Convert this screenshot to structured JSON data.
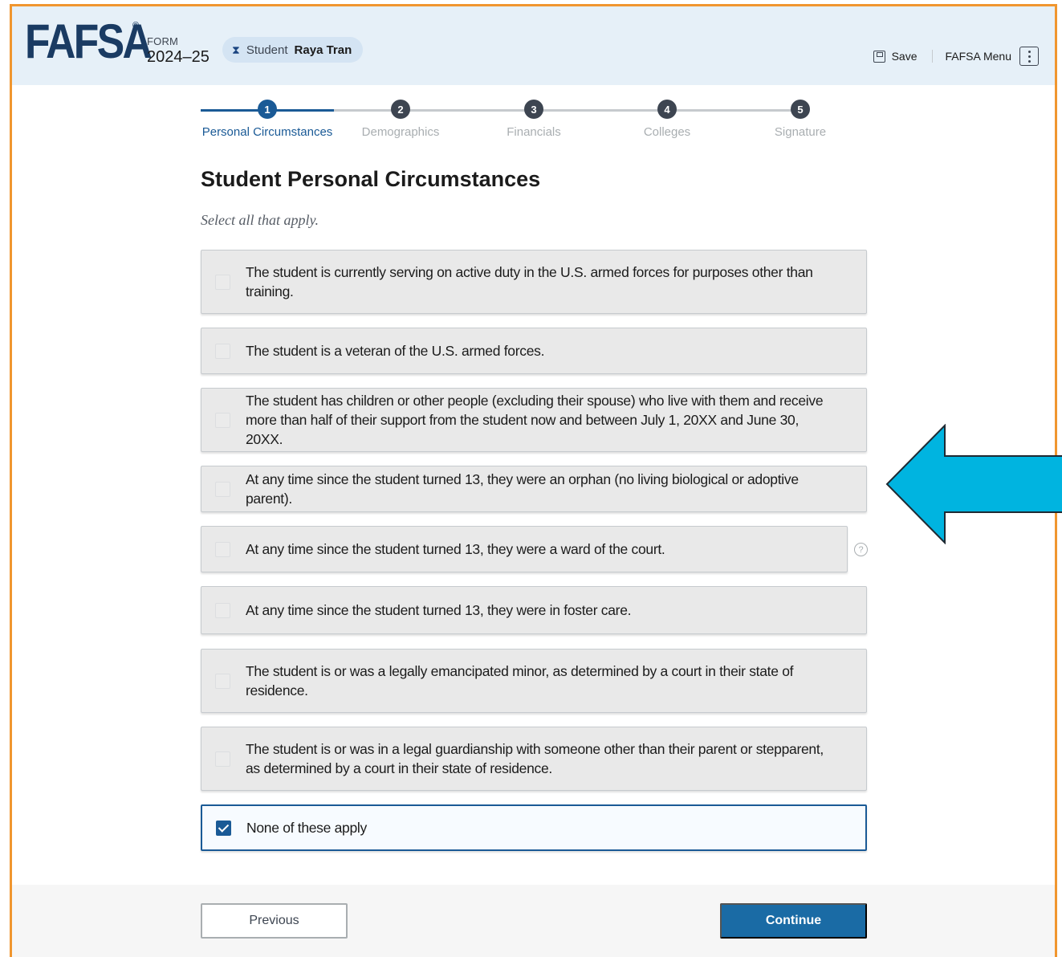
{
  "header": {
    "logo": "FAFSA",
    "logo_mark": "®",
    "form_label": "FORM",
    "form_year": "2024–25",
    "student_label": "Student",
    "student_name": "Raya Tran",
    "save_label": "Save",
    "menu_label": "FAFSA Menu",
    "student_icon": "hourglass-icon"
  },
  "stepper": {
    "active_step": 1,
    "steps": [
      {
        "number": "1",
        "label": "Personal Circumstances"
      },
      {
        "number": "2",
        "label": "Demographics"
      },
      {
        "number": "3",
        "label": "Financials"
      },
      {
        "number": "4",
        "label": "Colleges"
      },
      {
        "number": "5",
        "label": "Signature"
      }
    ]
  },
  "page": {
    "title": "Student Personal Circumstances",
    "subtitle": "Select all that apply."
  },
  "options": [
    {
      "text": "The student is currently serving on active duty in the U.S. armed forces for purposes other than training.",
      "checked": false
    },
    {
      "text": "The student is a veteran of the U.S. armed forces.",
      "checked": false
    },
    {
      "text": "The student has children or other people (excluding their spouse) who live with them and receive more than half of their support from the student now and between July 1, 20XX and June 30, 20XX.",
      "checked": false
    },
    {
      "text": "At any time since the student turned 13, they were an orphan (no living biological or adoptive parent).",
      "checked": false
    },
    {
      "text": "At any time since the student turned 13, they were a ward of the court.",
      "checked": false
    },
    {
      "text": "At any time since the student turned 13, they were in foster care.",
      "checked": false
    },
    {
      "text": "The student is or was a legally emancipated minor, as determined by a court in their state of residence.",
      "checked": false
    },
    {
      "text": "The student is or was in a legal guardianship with someone other than their parent or stepparent, as determined by a court in their state of residence.",
      "checked": false
    },
    {
      "text": "None of these apply",
      "checked": true
    }
  ],
  "help": {
    "glyph": "?"
  },
  "footer": {
    "previous_label": "Previous",
    "continue_label": "Continue"
  },
  "colors": {
    "frame_border": "#f0962f",
    "header_bg": "#e6f0f8",
    "primary": "#1a5a96",
    "annotation_arrow": "#00b4e0"
  }
}
